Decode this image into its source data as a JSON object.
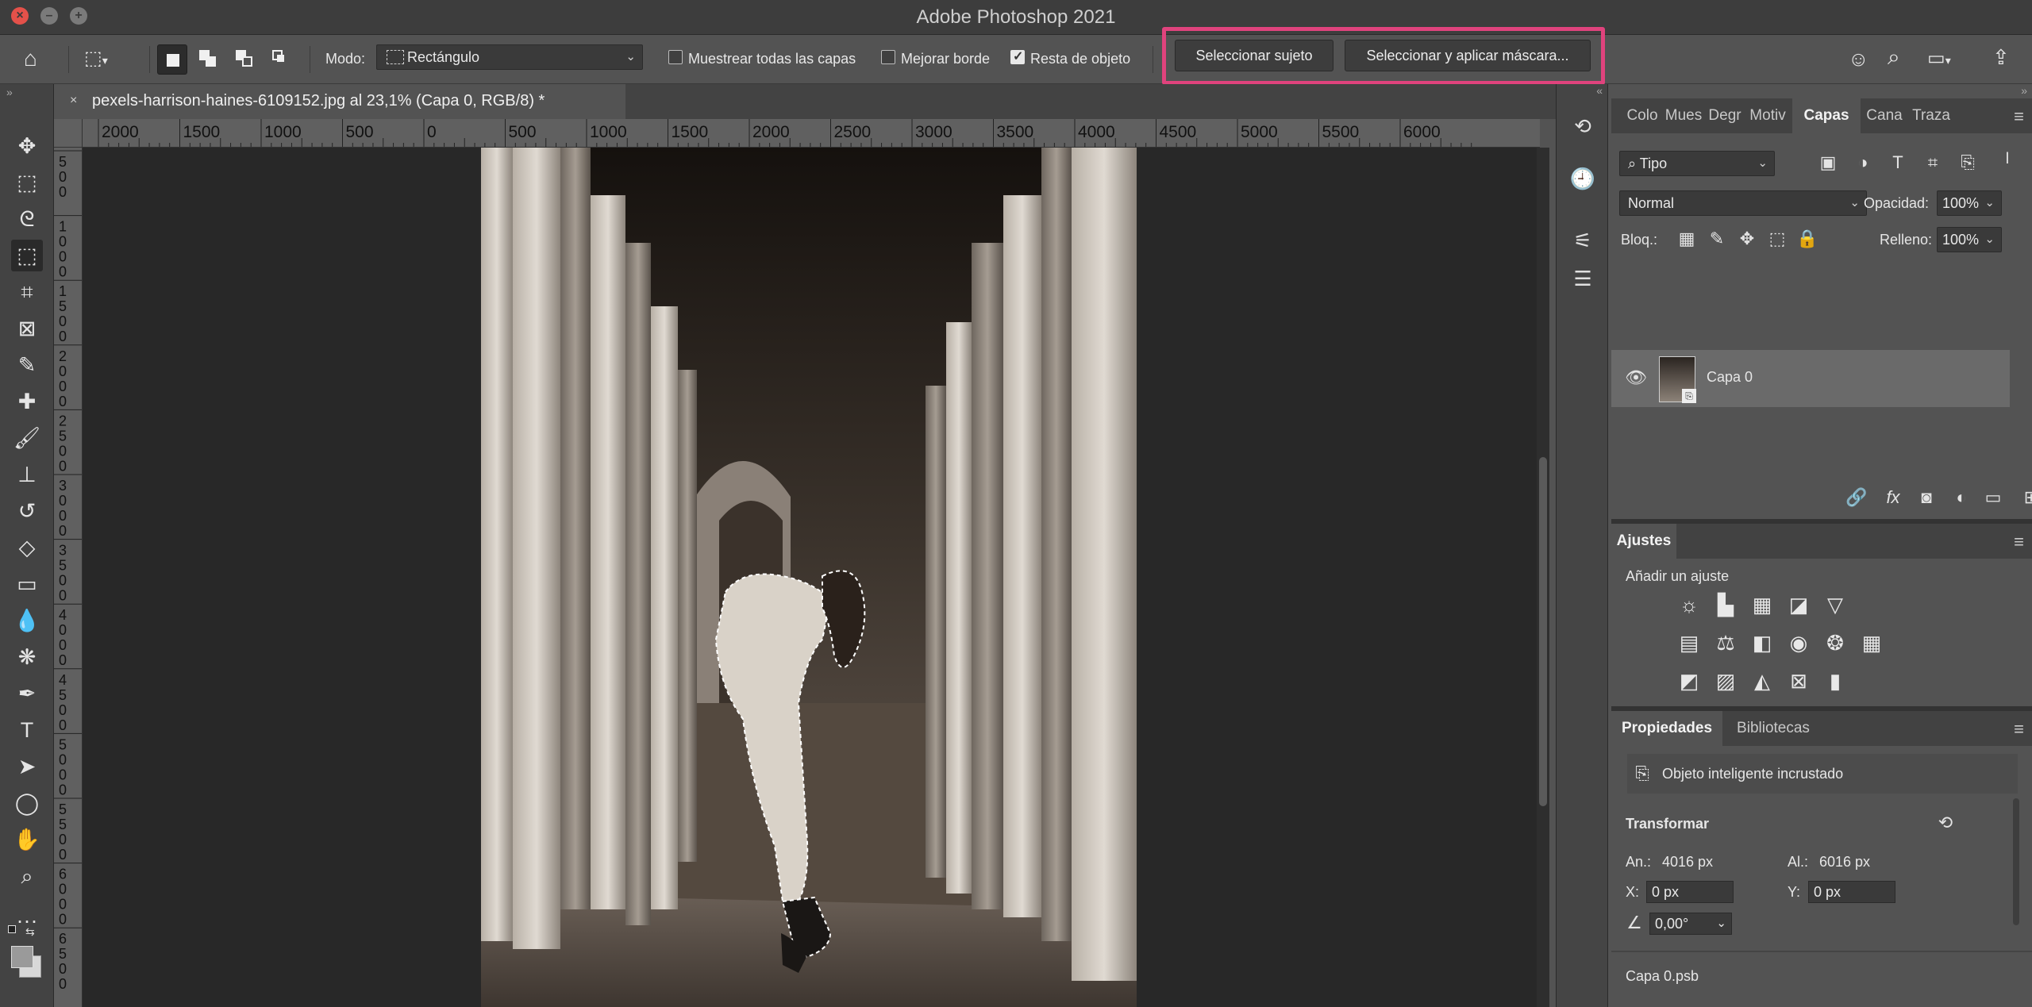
{
  "app": {
    "title": "Adobe Photoshop 2021"
  },
  "options": {
    "modo_label": "Modo:",
    "modo_value": "Rectángulo",
    "sample_all_label": "Muestrear todas las capas",
    "sample_all_checked": false,
    "enhance_edge_label": "Mejorar borde",
    "enhance_edge_checked": false,
    "subtract_label": "Resta de objeto",
    "subtract_checked": true,
    "select_subject_label": "Seleccionar sujeto",
    "select_mask_label": "Seleccionar y aplicar máscara...",
    "highlight_color": "#e0437d"
  },
  "document": {
    "tab_close": "×",
    "tab_title": "pexels-harrison-haines-6109152.jpg al 23,1% (Capa 0, RGB/8) *",
    "ruler_h_labels": [
      "2000",
      "1500",
      "1000",
      "500",
      "0",
      "500",
      "1000",
      "1500",
      "2000",
      "2500",
      "3000",
      "3500",
      "4000",
      "4500",
      "5000",
      "5500",
      "6000"
    ],
    "ruler_v_labels": [
      "5\n0\n0",
      "1\n0\n0\n0",
      "1\n5\n0\n0",
      "2\n0\n0\n0",
      "2\n5\n0\n0",
      "3\n0\n0\n0",
      "3\n5\n0\n0",
      "4\n0\n0\n0",
      "4\n5\n0\n0",
      "5\n0\n0\n0",
      "5\n5\n0\n0",
      "6\n0\n0\n0",
      "6\n5\n0\n0"
    ]
  },
  "tools": [
    {
      "name": "move-tool-icon",
      "glyph": "✥"
    },
    {
      "name": "rectangular-marquee-icon",
      "glyph": "⬚"
    },
    {
      "name": "lasso-tool-icon",
      "glyph": "ᘓ"
    },
    {
      "name": "object-selection-icon",
      "glyph": "⬚",
      "active": true
    },
    {
      "name": "crop-tool-icon",
      "glyph": "⌗"
    },
    {
      "name": "frame-tool-icon",
      "glyph": "⊠"
    },
    {
      "name": "eyedropper-icon",
      "glyph": "✎"
    },
    {
      "name": "healing-brush-icon",
      "glyph": "✚"
    },
    {
      "name": "brush-tool-icon",
      "glyph": "🖌"
    },
    {
      "name": "clone-stamp-icon",
      "glyph": "⊥"
    },
    {
      "name": "history-brush-icon",
      "glyph": "↺"
    },
    {
      "name": "eraser-icon",
      "glyph": "◇"
    },
    {
      "name": "gradient-tool-icon",
      "glyph": "▭"
    },
    {
      "name": "blur-tool-icon",
      "glyph": "💧"
    },
    {
      "name": "dodge-tool-icon",
      "glyph": "❋"
    },
    {
      "name": "pen-tool-icon",
      "glyph": "✒"
    },
    {
      "name": "type-tool-icon",
      "glyph": "T"
    },
    {
      "name": "path-selection-icon",
      "glyph": "➤"
    },
    {
      "name": "ellipse-tool-icon",
      "glyph": "◯"
    },
    {
      "name": "hand-tool-icon",
      "glyph": "✋"
    },
    {
      "name": "zoom-tool-icon",
      "glyph": "⌕"
    },
    {
      "name": "more-tools-icon",
      "glyph": "···"
    }
  ],
  "layers_panel": {
    "tabs": [
      "Colo",
      "Mues",
      "Degr",
      "Motiv",
      "Capas",
      "Cana",
      "Traza"
    ],
    "active_tab": "Capas",
    "filter_value": "Tipo",
    "blend_mode": "Normal",
    "opacity_label": "Opacidad:",
    "opacity_value": "100%",
    "lock_label": "Bloq.:",
    "fill_label": "Relleno:",
    "fill_value": "100%",
    "layers": [
      {
        "name": "Capa 0",
        "visible": true
      }
    ]
  },
  "adjustments_panel": {
    "tab": "Ajustes",
    "add_label": "Añadir un ajuste"
  },
  "properties_panel": {
    "tabs": [
      "Propiedades",
      "Bibliotecas"
    ],
    "active_tab": "Propiedades",
    "object_type": "Objeto inteligente incrustado",
    "transform_label": "Transformar",
    "width_label": "An.:",
    "width_value": "4016 px",
    "height_label": "Al.:",
    "height_value": "6016 px",
    "x_label": "X:",
    "x_value": "0 px",
    "y_label": "Y:",
    "y_value": "0 px",
    "angle_value": "0,00°",
    "file_name": "Capa 0.psb"
  }
}
